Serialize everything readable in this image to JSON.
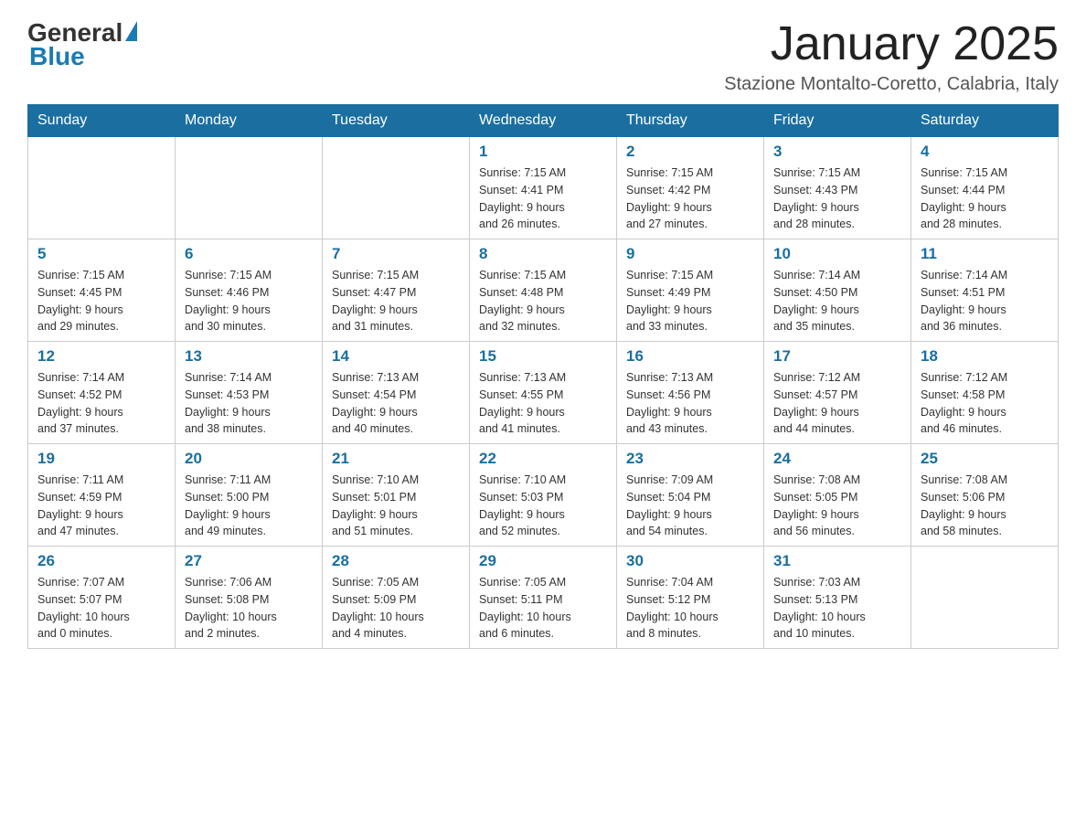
{
  "header": {
    "logo_general": "General",
    "logo_blue": "Blue",
    "month_title": "January 2025",
    "location": "Stazione Montalto-Coretto, Calabria, Italy"
  },
  "weekdays": [
    "Sunday",
    "Monday",
    "Tuesday",
    "Wednesday",
    "Thursday",
    "Friday",
    "Saturday"
  ],
  "weeks": [
    [
      {
        "day": "",
        "info": ""
      },
      {
        "day": "",
        "info": ""
      },
      {
        "day": "",
        "info": ""
      },
      {
        "day": "1",
        "info": "Sunrise: 7:15 AM\nSunset: 4:41 PM\nDaylight: 9 hours\nand 26 minutes."
      },
      {
        "day": "2",
        "info": "Sunrise: 7:15 AM\nSunset: 4:42 PM\nDaylight: 9 hours\nand 27 minutes."
      },
      {
        "day": "3",
        "info": "Sunrise: 7:15 AM\nSunset: 4:43 PM\nDaylight: 9 hours\nand 28 minutes."
      },
      {
        "day": "4",
        "info": "Sunrise: 7:15 AM\nSunset: 4:44 PM\nDaylight: 9 hours\nand 28 minutes."
      }
    ],
    [
      {
        "day": "5",
        "info": "Sunrise: 7:15 AM\nSunset: 4:45 PM\nDaylight: 9 hours\nand 29 minutes."
      },
      {
        "day": "6",
        "info": "Sunrise: 7:15 AM\nSunset: 4:46 PM\nDaylight: 9 hours\nand 30 minutes."
      },
      {
        "day": "7",
        "info": "Sunrise: 7:15 AM\nSunset: 4:47 PM\nDaylight: 9 hours\nand 31 minutes."
      },
      {
        "day": "8",
        "info": "Sunrise: 7:15 AM\nSunset: 4:48 PM\nDaylight: 9 hours\nand 32 minutes."
      },
      {
        "day": "9",
        "info": "Sunrise: 7:15 AM\nSunset: 4:49 PM\nDaylight: 9 hours\nand 33 minutes."
      },
      {
        "day": "10",
        "info": "Sunrise: 7:14 AM\nSunset: 4:50 PM\nDaylight: 9 hours\nand 35 minutes."
      },
      {
        "day": "11",
        "info": "Sunrise: 7:14 AM\nSunset: 4:51 PM\nDaylight: 9 hours\nand 36 minutes."
      }
    ],
    [
      {
        "day": "12",
        "info": "Sunrise: 7:14 AM\nSunset: 4:52 PM\nDaylight: 9 hours\nand 37 minutes."
      },
      {
        "day": "13",
        "info": "Sunrise: 7:14 AM\nSunset: 4:53 PM\nDaylight: 9 hours\nand 38 minutes."
      },
      {
        "day": "14",
        "info": "Sunrise: 7:13 AM\nSunset: 4:54 PM\nDaylight: 9 hours\nand 40 minutes."
      },
      {
        "day": "15",
        "info": "Sunrise: 7:13 AM\nSunset: 4:55 PM\nDaylight: 9 hours\nand 41 minutes."
      },
      {
        "day": "16",
        "info": "Sunrise: 7:13 AM\nSunset: 4:56 PM\nDaylight: 9 hours\nand 43 minutes."
      },
      {
        "day": "17",
        "info": "Sunrise: 7:12 AM\nSunset: 4:57 PM\nDaylight: 9 hours\nand 44 minutes."
      },
      {
        "day": "18",
        "info": "Sunrise: 7:12 AM\nSunset: 4:58 PM\nDaylight: 9 hours\nand 46 minutes."
      }
    ],
    [
      {
        "day": "19",
        "info": "Sunrise: 7:11 AM\nSunset: 4:59 PM\nDaylight: 9 hours\nand 47 minutes."
      },
      {
        "day": "20",
        "info": "Sunrise: 7:11 AM\nSunset: 5:00 PM\nDaylight: 9 hours\nand 49 minutes."
      },
      {
        "day": "21",
        "info": "Sunrise: 7:10 AM\nSunset: 5:01 PM\nDaylight: 9 hours\nand 51 minutes."
      },
      {
        "day": "22",
        "info": "Sunrise: 7:10 AM\nSunset: 5:03 PM\nDaylight: 9 hours\nand 52 minutes."
      },
      {
        "day": "23",
        "info": "Sunrise: 7:09 AM\nSunset: 5:04 PM\nDaylight: 9 hours\nand 54 minutes."
      },
      {
        "day": "24",
        "info": "Sunrise: 7:08 AM\nSunset: 5:05 PM\nDaylight: 9 hours\nand 56 minutes."
      },
      {
        "day": "25",
        "info": "Sunrise: 7:08 AM\nSunset: 5:06 PM\nDaylight: 9 hours\nand 58 minutes."
      }
    ],
    [
      {
        "day": "26",
        "info": "Sunrise: 7:07 AM\nSunset: 5:07 PM\nDaylight: 10 hours\nand 0 minutes."
      },
      {
        "day": "27",
        "info": "Sunrise: 7:06 AM\nSunset: 5:08 PM\nDaylight: 10 hours\nand 2 minutes."
      },
      {
        "day": "28",
        "info": "Sunrise: 7:05 AM\nSunset: 5:09 PM\nDaylight: 10 hours\nand 4 minutes."
      },
      {
        "day": "29",
        "info": "Sunrise: 7:05 AM\nSunset: 5:11 PM\nDaylight: 10 hours\nand 6 minutes."
      },
      {
        "day": "30",
        "info": "Sunrise: 7:04 AM\nSunset: 5:12 PM\nDaylight: 10 hours\nand 8 minutes."
      },
      {
        "day": "31",
        "info": "Sunrise: 7:03 AM\nSunset: 5:13 PM\nDaylight: 10 hours\nand 10 minutes."
      },
      {
        "day": "",
        "info": ""
      }
    ]
  ]
}
